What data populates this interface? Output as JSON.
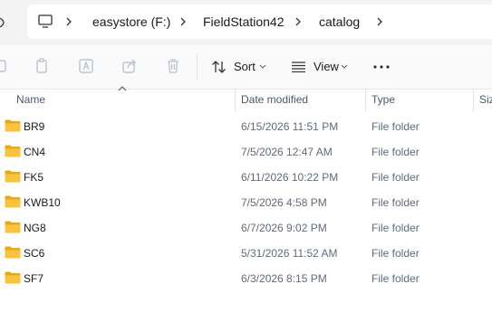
{
  "address_bar": {
    "crumbs": [
      "easystore (F:)",
      "FieldStation42",
      "catalog"
    ]
  },
  "toolbar": {
    "sort_label": "Sort",
    "view_label": "View",
    "more_label": "···"
  },
  "columns": {
    "name": "Name",
    "date_modified": "Date modified",
    "type": "Type",
    "size": "Size"
  },
  "rows": [
    {
      "name": "BR9",
      "date": "6/15/2026 11:51 PM",
      "type": "File folder"
    },
    {
      "name": "CN4",
      "date": "7/5/2026 12:47 AM",
      "type": "File folder"
    },
    {
      "name": "FK5",
      "date": "6/11/2026 10:22 PM",
      "type": "File folder"
    },
    {
      "name": "KWB10",
      "date": "7/5/2026 4:58 PM",
      "type": "File folder"
    },
    {
      "name": "NG8",
      "date": "6/7/2026 9:02 PM",
      "type": "File folder"
    },
    {
      "name": "SC6",
      "date": "5/31/2026 11:52 AM",
      "type": "File folder"
    },
    {
      "name": "SF7",
      "date": "6/3/2026 8:15 PM",
      "type": "File folder"
    }
  ],
  "colors": {
    "folder": "#f8c33f",
    "folder_dark": "#e8a917",
    "header_text": "#4a5a6e",
    "disabled_icon": "#b9c4d0"
  }
}
